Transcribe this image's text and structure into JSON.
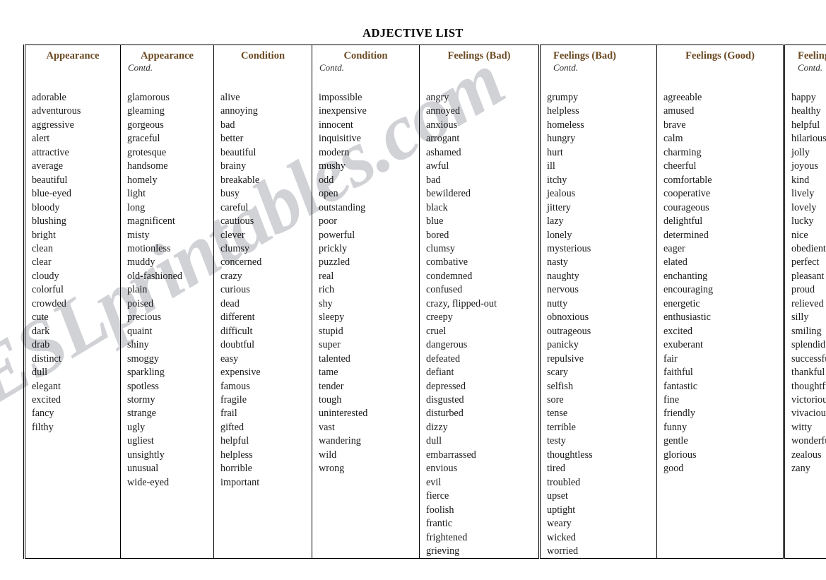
{
  "document": {
    "title": "ADJECTIVE LIST",
    "watermark": "ESLprintables.com",
    "header_color": "#6b4a23",
    "text_color": "#1a1a1a",
    "border_color": "#000000",
    "background_color": "#ffffff"
  },
  "table": {
    "columns": [
      {
        "header": "Appearance",
        "subheader": "",
        "header_align": "center",
        "words": [
          "adorable",
          "adventurous",
          "aggressive",
          "alert",
          "attractive",
          "average",
          "beautiful",
          "blue-eyed",
          "bloody",
          "blushing",
          "bright",
          "clean",
          "clear",
          "cloudy",
          "colorful",
          "crowded",
          "cute",
          "dark",
          "drab",
          "distinct",
          "dull",
          "elegant",
          "excited",
          "fancy",
          "filthy"
        ]
      },
      {
        "header": "Appearance",
        "subheader": "Contd.",
        "header_align": "center",
        "words": [
          "glamorous",
          "gleaming",
          "gorgeous",
          "graceful",
          "grotesque",
          "handsome",
          "homely",
          "light",
          "long",
          "magnificent",
          "misty",
          "motionless",
          "muddy",
          "old-fashioned",
          "plain",
          "poised",
          "precious",
          "quaint",
          "shiny",
          "smoggy",
          "sparkling",
          "spotless",
          "stormy",
          "strange",
          "ugly",
          "ugliest",
          "unsightly",
          "unusual",
          "wide-eyed"
        ]
      },
      {
        "header": "Condition",
        "subheader": "",
        "header_align": "center",
        "words": [
          "alive",
          "annoying",
          "bad",
          "better",
          "beautiful",
          "brainy",
          "breakable",
          "busy",
          "careful",
          "cautious",
          "clever",
          "clumsy",
          "concerned",
          "crazy",
          "curious",
          "dead",
          "different",
          "difficult",
          "doubtful",
          "easy",
          "expensive",
          "famous",
          "fragile",
          "frail",
          "gifted",
          "helpful",
          "helpless",
          "horrible",
          "important"
        ]
      },
      {
        "header": "Condition",
        "subheader": "Contd.",
        "header_align": "center",
        "words": [
          "impossible",
          "inexpensive",
          "innocent",
          "inquisitive",
          "modern",
          "mushy",
          "odd",
          "open",
          "outstanding",
          "poor",
          "powerful",
          "prickly",
          "puzzled",
          "real",
          "rich",
          "shy",
          "sleepy",
          "stupid",
          "super",
          "talented",
          "tame",
          "tender",
          "tough",
          "uninterested",
          "vast",
          "wandering",
          "wild",
          "wrong"
        ]
      },
      {
        "header": "Feelings (Bad)",
        "subheader": "",
        "header_align": "center",
        "words": [
          "angry",
          "annoyed",
          "anxious",
          "arrogant",
          "ashamed",
          "awful",
          "bad",
          "bewildered",
          "black",
          "blue",
          "bored",
          "clumsy",
          "combative",
          "condemned",
          "confused",
          "crazy, flipped-out",
          "creepy",
          "cruel",
          "dangerous",
          "defeated",
          "defiant",
          "depressed",
          "disgusted",
          "disturbed",
          "dizzy",
          "dull",
          "embarrassed",
          "envious",
          "evil",
          "fierce",
          "foolish",
          "frantic",
          "frightened",
          "grieving"
        ]
      },
      {
        "header": "Feelings (Bad)",
        "subheader": "Contd.",
        "header_align": "left",
        "words": [
          "grumpy",
          "helpless",
          "homeless",
          "hungry",
          "hurt",
          "ill",
          "itchy",
          "jealous",
          "jittery",
          "lazy",
          "lonely",
          "mysterious",
          "nasty",
          "naughty",
          "nervous",
          "nutty",
          "obnoxious",
          "outrageous",
          "panicky",
          "repulsive",
          "scary",
          "selfish",
          "sore",
          "tense",
          "terrible",
          "testy",
          "thoughtless",
          "tired",
          "troubled",
          "upset",
          "uptight",
          "weary",
          "wicked",
          "worried"
        ]
      },
      {
        "header": "Feelings (Good)",
        "subheader": "",
        "header_align": "center",
        "words": [
          "agreeable",
          "amused",
          "brave",
          "calm",
          "charming",
          "cheerful",
          "comfortable",
          "cooperative",
          "courageous",
          "delightful",
          "determined",
          "eager",
          "elated",
          "enchanting",
          "encouraging",
          "energetic",
          "enthusiastic",
          "excited",
          "exuberant",
          "fair",
          "faithful",
          "fantastic",
          "fine",
          "friendly",
          "funny",
          "gentle",
          "glorious",
          "good"
        ]
      },
      {
        "header": "Feelings (Good)",
        "subheader": "Contd.",
        "header_align": "left",
        "words": [
          "happy",
          "healthy",
          "helpful",
          "hilarious",
          "jolly",
          "joyous",
          "kind",
          "lively",
          "lovely",
          "lucky",
          "nice",
          "obedient",
          "perfect",
          "pleasant",
          "proud",
          "relieved",
          "silly",
          "smiling",
          "splendid",
          "successful",
          "thankful",
          "thoughtful",
          "victorious",
          "vivacious",
          "witty",
          "wonderful",
          "zealous",
          "zany"
        ]
      }
    ]
  }
}
